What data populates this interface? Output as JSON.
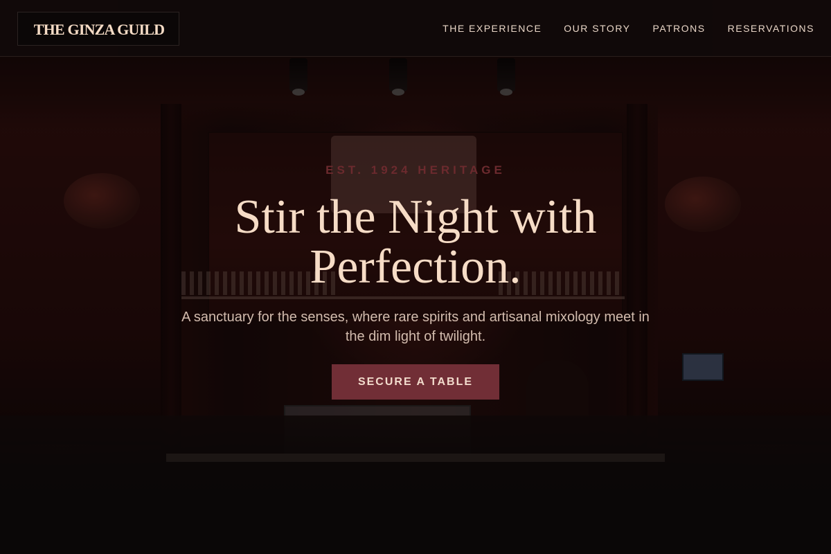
{
  "header": {
    "logo": "THE GINZA GUILD",
    "nav": [
      {
        "label": "THE EXPERIENCE"
      },
      {
        "label": "OUR STORY"
      },
      {
        "label": "PATRONS"
      },
      {
        "label": "RESERVATIONS"
      }
    ]
  },
  "hero": {
    "eyebrow": "EST. 1924 HERITAGE",
    "title": "Stir the Night with Perfection.",
    "subtitle": "A sanctuary for the senses, where rare spirits and artisanal mixology meet in the dim light of twilight.",
    "cta_label": "SECURE A TABLE"
  },
  "colors": {
    "accent": "#712e36",
    "heading": "#f6dcc6",
    "eyebrow": "#6c2a2e",
    "header_bg": "#100a0a"
  }
}
